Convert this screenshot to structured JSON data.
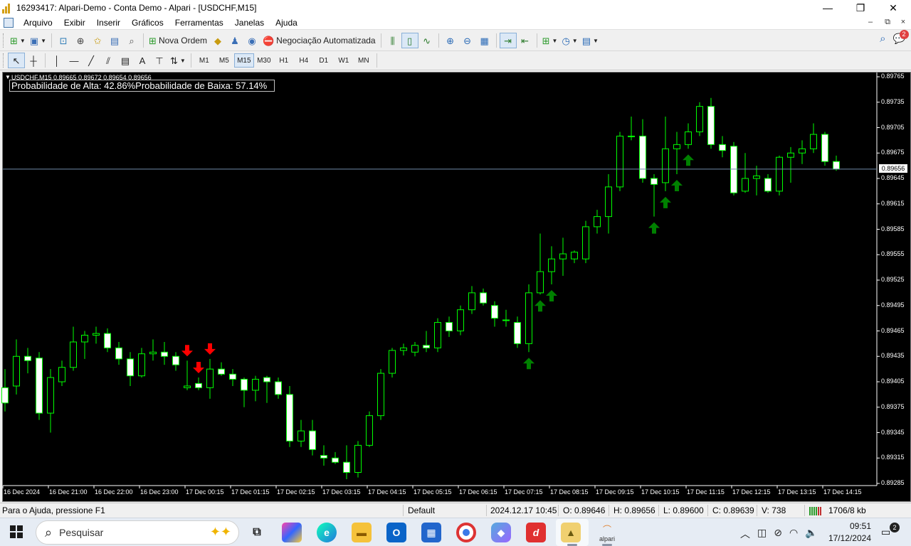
{
  "window": {
    "title": "16293417: Alpari-Demo - Conta Demo - Alpari - [USDCHF,M15]",
    "controls": {
      "minimize": "—",
      "maximize": "❐",
      "close": "✕"
    }
  },
  "menu": {
    "items": [
      "Arquivo",
      "Exibir",
      "Inserir",
      "Gráficos",
      "Ferramentas",
      "Janelas",
      "Ajuda"
    ],
    "mdi": [
      "–",
      "⧉",
      "×"
    ]
  },
  "toolbar1": {
    "new_order_label": "Nova Ordem",
    "auto_trading_label": "Negociação Automatizada",
    "notifications_count": "2"
  },
  "toolbar2": {
    "timeframes": [
      "M1",
      "M5",
      "M15",
      "M30",
      "H1",
      "H4",
      "D1",
      "W1",
      "MN"
    ],
    "active_timeframe": "M15"
  },
  "chart": {
    "symbol_line": "USDCHF,M15  0.89665 0.89672 0.89654 0.89656",
    "probability_text": "Probabilidade de Alta: 42.86%Probabilidade de Baixa: 57.14%",
    "current_price": "0.89656",
    "price_ticks": [
      "0.89765",
      "0.89735",
      "0.89705",
      "0.89675",
      "0.89645",
      "0.89615",
      "0.89585",
      "0.89555",
      "0.89525",
      "0.89495",
      "0.89465",
      "0.89435",
      "0.89405",
      "0.89375",
      "0.89345",
      "0.89315",
      "0.89285"
    ],
    "time_ticks": [
      "16 Dec 2024",
      "16 Dec 21:00",
      "16 Dec 22:00",
      "16 Dec 23:00",
      "17 Dec 00:15",
      "17 Dec 01:15",
      "17 Dec 02:15",
      "17 Dec 03:15",
      "17 Dec 04:15",
      "17 Dec 05:15",
      "17 Dec 06:15",
      "17 Dec 07:15",
      "17 Dec 08:15",
      "17 Dec 09:15",
      "17 Dec 10:15",
      "17 Dec 11:15",
      "17 Dec 12:15",
      "17 Dec 13:15",
      "17 Dec 14:15"
    ],
    "colors": {
      "background": "#000000",
      "bull_candle": "#000000",
      "bear_candle": "#ffffff",
      "wick": "#00ff00",
      "up_arrow": "#008000",
      "down_arrow": "#ff0000",
      "bid_line": "#708ba8"
    }
  },
  "chart_data": {
    "type": "candlestick",
    "symbol": "USDCHF",
    "timeframe": "M15",
    "ylim": [
      0.8928,
      0.8977
    ],
    "candles": [
      {
        "o": 0.89398,
        "h": 0.8942,
        "l": 0.8937,
        "c": 0.8938
      },
      {
        "o": 0.894,
        "h": 0.89455,
        "l": 0.8939,
        "c": 0.89435
      },
      {
        "o": 0.89435,
        "h": 0.89445,
        "l": 0.89415,
        "c": 0.8943
      },
      {
        "o": 0.89433,
        "h": 0.8944,
        "l": 0.8936,
        "c": 0.89368
      },
      {
        "o": 0.89368,
        "h": 0.8942,
        "l": 0.89345,
        "c": 0.8941
      },
      {
        "o": 0.89405,
        "h": 0.8943,
        "l": 0.894,
        "c": 0.89422
      },
      {
        "o": 0.89422,
        "h": 0.8947,
        "l": 0.89418,
        "c": 0.89452
      },
      {
        "o": 0.89452,
        "h": 0.89465,
        "l": 0.89432,
        "c": 0.8946
      },
      {
        "o": 0.8946,
        "h": 0.8947,
        "l": 0.8945,
        "c": 0.89462
      },
      {
        "o": 0.89462,
        "h": 0.89468,
        "l": 0.8944,
        "c": 0.89445
      },
      {
        "o": 0.89445,
        "h": 0.89452,
        "l": 0.89425,
        "c": 0.89432
      },
      {
        "o": 0.89432,
        "h": 0.8944,
        "l": 0.894,
        "c": 0.89412
      },
      {
        "o": 0.89412,
        "h": 0.89445,
        "l": 0.8941,
        "c": 0.89438
      },
      {
        "o": 0.89438,
        "h": 0.89455,
        "l": 0.8943,
        "c": 0.8944
      },
      {
        "o": 0.8944,
        "h": 0.89452,
        "l": 0.89425,
        "c": 0.89435
      },
      {
        "o": 0.89435,
        "h": 0.8944,
        "l": 0.89418,
        "c": 0.89425
      },
      {
        "o": 0.89398,
        "h": 0.8943,
        "l": 0.89395,
        "c": 0.894
      },
      {
        "o": 0.89403,
        "h": 0.8941,
        "l": 0.89395,
        "c": 0.89398
      },
      {
        "o": 0.89398,
        "h": 0.89432,
        "l": 0.89385,
        "c": 0.8942
      },
      {
        "o": 0.8942,
        "h": 0.89428,
        "l": 0.89412,
        "c": 0.89414
      },
      {
        "o": 0.89414,
        "h": 0.8942,
        "l": 0.894,
        "c": 0.89408
      },
      {
        "o": 0.89408,
        "h": 0.8941,
        "l": 0.89375,
        "c": 0.89395
      },
      {
        "o": 0.89395,
        "h": 0.89412,
        "l": 0.89382,
        "c": 0.89408
      },
      {
        "o": 0.8941,
        "h": 0.89412,
        "l": 0.8938,
        "c": 0.89405
      },
      {
        "o": 0.89405,
        "h": 0.8941,
        "l": 0.89385,
        "c": 0.8939
      },
      {
        "o": 0.8939,
        "h": 0.894,
        "l": 0.89328,
        "c": 0.89335
      },
      {
        "o": 0.89335,
        "h": 0.8936,
        "l": 0.89328,
        "c": 0.89347
      },
      {
        "o": 0.89347,
        "h": 0.8936,
        "l": 0.89318,
        "c": 0.89325
      },
      {
        "o": 0.89318,
        "h": 0.8933,
        "l": 0.89306,
        "c": 0.89315
      },
      {
        "o": 0.89315,
        "h": 0.89322,
        "l": 0.89308,
        "c": 0.8931
      },
      {
        "o": 0.8931,
        "h": 0.8933,
        "l": 0.8929,
        "c": 0.89298
      },
      {
        "o": 0.89298,
        "h": 0.89335,
        "l": 0.89292,
        "c": 0.8933
      },
      {
        "o": 0.8933,
        "h": 0.8937,
        "l": 0.89328,
        "c": 0.89365
      },
      {
        "o": 0.89365,
        "h": 0.8942,
        "l": 0.8936,
        "c": 0.89415
      },
      {
        "o": 0.89415,
        "h": 0.89445,
        "l": 0.8941,
        "c": 0.89442
      },
      {
        "o": 0.89442,
        "h": 0.8945,
        "l": 0.89436,
        "c": 0.89445
      },
      {
        "o": 0.8944,
        "h": 0.89452,
        "l": 0.89435,
        "c": 0.89448
      },
      {
        "o": 0.89448,
        "h": 0.89465,
        "l": 0.8944,
        "c": 0.89445
      },
      {
        "o": 0.89445,
        "h": 0.8948,
        "l": 0.8944,
        "c": 0.89475
      },
      {
        "o": 0.89475,
        "h": 0.89482,
        "l": 0.89458,
        "c": 0.89465
      },
      {
        "o": 0.89465,
        "h": 0.89495,
        "l": 0.8946,
        "c": 0.8949
      },
      {
        "o": 0.8949,
        "h": 0.89518,
        "l": 0.89485,
        "c": 0.8951
      },
      {
        "o": 0.8951,
        "h": 0.89515,
        "l": 0.89495,
        "c": 0.89498
      },
      {
        "o": 0.89495,
        "h": 0.895,
        "l": 0.8947,
        "c": 0.8948
      },
      {
        "o": 0.89478,
        "h": 0.8949,
        "l": 0.8947,
        "c": 0.89478
      },
      {
        "o": 0.89475,
        "h": 0.89482,
        "l": 0.89445,
        "c": 0.8945
      },
      {
        "o": 0.8945,
        "h": 0.8952,
        "l": 0.8944,
        "c": 0.8951
      },
      {
        "o": 0.8951,
        "h": 0.8958,
        "l": 0.89508,
        "c": 0.89535
      },
      {
        "o": 0.89535,
        "h": 0.89565,
        "l": 0.8952,
        "c": 0.8955
      },
      {
        "o": 0.8955,
        "h": 0.89575,
        "l": 0.8953,
        "c": 0.89556
      },
      {
        "o": 0.8955,
        "h": 0.8956,
        "l": 0.89545,
        "c": 0.89558
      },
      {
        "o": 0.8955,
        "h": 0.89595,
        "l": 0.89545,
        "c": 0.89588
      },
      {
        "o": 0.89588,
        "h": 0.89608,
        "l": 0.8958,
        "c": 0.896
      },
      {
        "o": 0.896,
        "h": 0.8965,
        "l": 0.8958,
        "c": 0.89635
      },
      {
        "o": 0.89635,
        "h": 0.897,
        "l": 0.8963,
        "c": 0.89695
      },
      {
        "o": 0.89695,
        "h": 0.89718,
        "l": 0.8969,
        "c": 0.89695
      },
      {
        "o": 0.89695,
        "h": 0.89715,
        "l": 0.8964,
        "c": 0.89645
      },
      {
        "o": 0.89645,
        "h": 0.8965,
        "l": 0.896,
        "c": 0.89638
      },
      {
        "o": 0.8964,
        "h": 0.89718,
        "l": 0.8963,
        "c": 0.8968
      },
      {
        "o": 0.8968,
        "h": 0.897,
        "l": 0.8965,
        "c": 0.89685
      },
      {
        "o": 0.89685,
        "h": 0.8971,
        "l": 0.8968,
        "c": 0.897
      },
      {
        "o": 0.897,
        "h": 0.89735,
        "l": 0.89695,
        "c": 0.8973
      },
      {
        "o": 0.8973,
        "h": 0.8974,
        "l": 0.8968,
        "c": 0.89685
      },
      {
        "o": 0.89685,
        "h": 0.89695,
        "l": 0.8967,
        "c": 0.89678
      },
      {
        "o": 0.89683,
        "h": 0.89688,
        "l": 0.89625,
        "c": 0.89628
      },
      {
        "o": 0.8963,
        "h": 0.89675,
        "l": 0.89628,
        "c": 0.89645
      },
      {
        "o": 0.89645,
        "h": 0.8966,
        "l": 0.89625,
        "c": 0.89648
      },
      {
        "o": 0.89645,
        "h": 0.8965,
        "l": 0.89628,
        "c": 0.8963
      },
      {
        "o": 0.8963,
        "h": 0.89672,
        "l": 0.89625,
        "c": 0.8967
      },
      {
        "o": 0.8967,
        "h": 0.89682,
        "l": 0.8964,
        "c": 0.89675
      },
      {
        "o": 0.89675,
        "h": 0.8969,
        "l": 0.89662,
        "c": 0.8968
      },
      {
        "o": 0.8968,
        "h": 0.8971,
        "l": 0.89675,
        "c": 0.89697
      },
      {
        "o": 0.89697,
        "h": 0.897,
        "l": 0.8966,
        "c": 0.89665
      },
      {
        "o": 0.89665,
        "h": 0.89672,
        "l": 0.89654,
        "c": 0.89656
      }
    ],
    "up_arrows_at": [
      46,
      47,
      48,
      57,
      58,
      59,
      60
    ],
    "down_arrows_at": [
      16,
      17,
      18
    ]
  },
  "statusbar": {
    "help": "Para o Ajuda, pressione F1",
    "profile": "Default",
    "datetime": "2024.12.17 10:45",
    "open": "O: 0.89646",
    "high": "H: 0.89656",
    "low": "L: 0.89600",
    "close": "C: 0.89639",
    "volume": "V: 738",
    "traffic": "1706/8 kb"
  },
  "taskbar": {
    "search_placeholder": "Pesquisar",
    "clock_time": "09:51",
    "clock_date": "17/12/2024",
    "notification_count": "2",
    "alpari_label": "alpari"
  }
}
